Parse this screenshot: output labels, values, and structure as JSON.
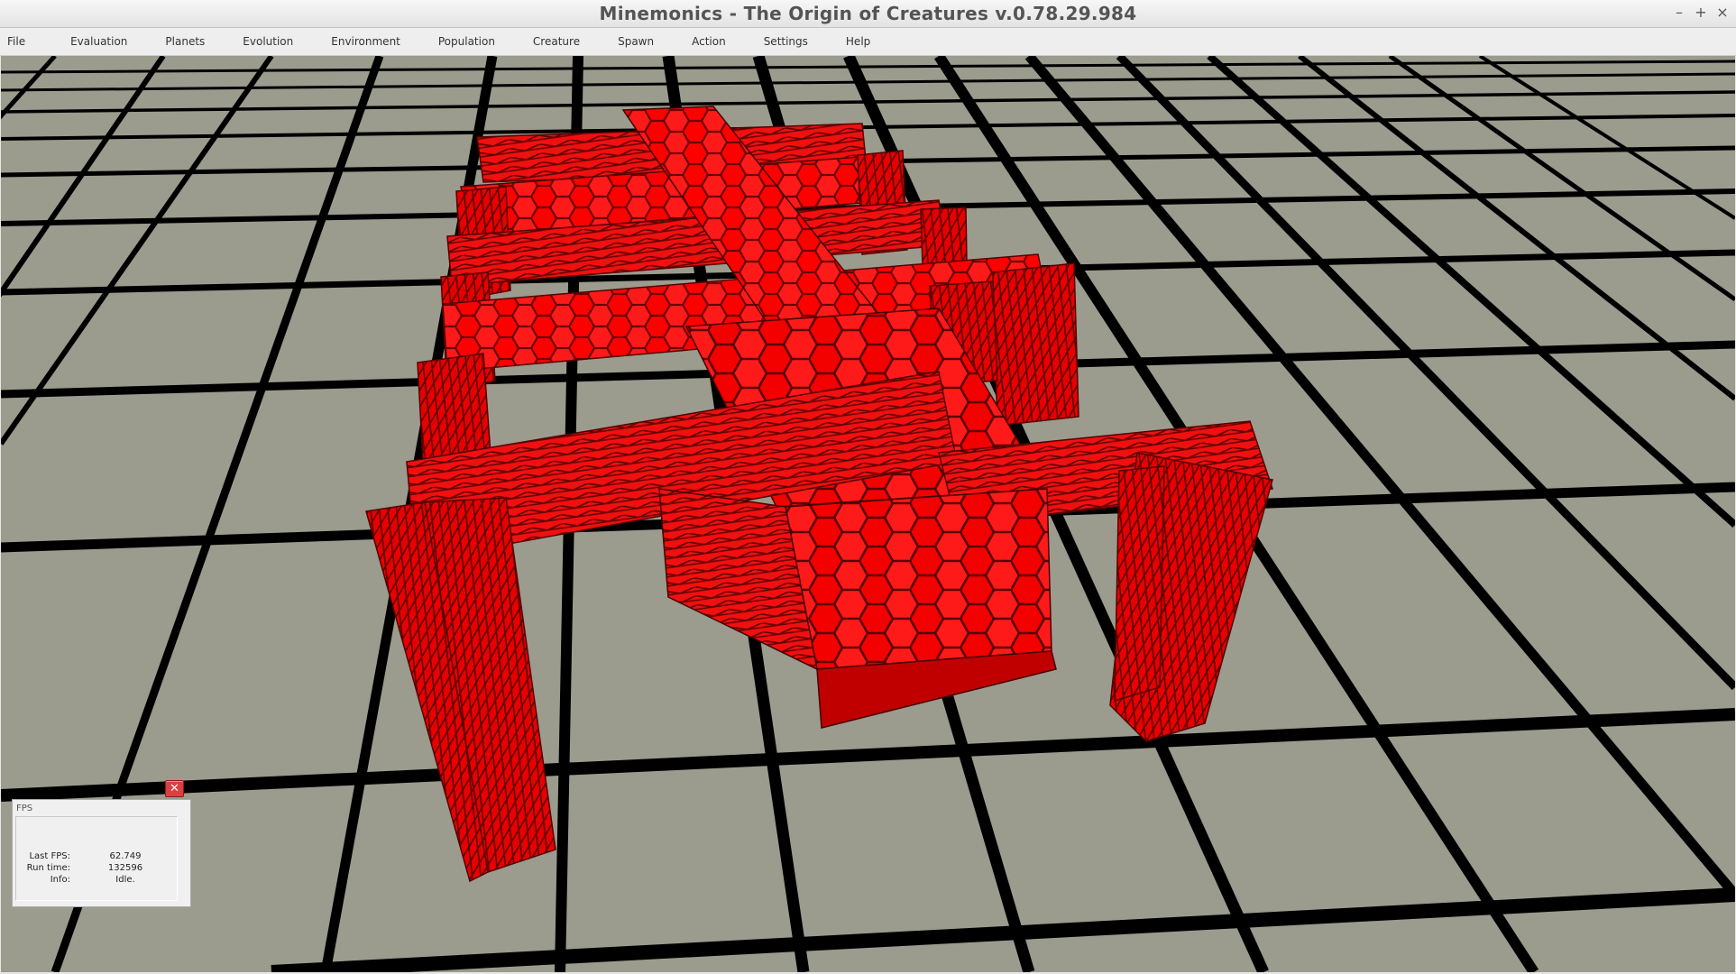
{
  "window": {
    "title": "Minemonics - The Origin of Creatures v.0.78.29.984",
    "minimize_glyph": "–",
    "maximize_glyph": "+",
    "close_glyph": "×"
  },
  "menu": [
    "File",
    "Evaluation",
    "Planets",
    "Evolution",
    "Environment",
    "Population",
    "Creature",
    "Spawn",
    "Action",
    "Settings",
    "Help"
  ],
  "fps_panel": {
    "title": "FPS",
    "close_glyph": "✕",
    "rows": [
      {
        "label": "Last FPS:",
        "value": "62.749"
      },
      {
        "label": "Run time:",
        "value": "132596"
      },
      {
        "label": "Info:",
        "value": "Idle."
      }
    ]
  },
  "colors": {
    "ground": "#9b9b8e",
    "grid_line": "#000000",
    "creature": "#ff1010",
    "creature_dark": "#8a0000"
  },
  "icons": {
    "close": "close-icon",
    "minimize": "minimize-icon",
    "maximize": "maximize-icon"
  }
}
